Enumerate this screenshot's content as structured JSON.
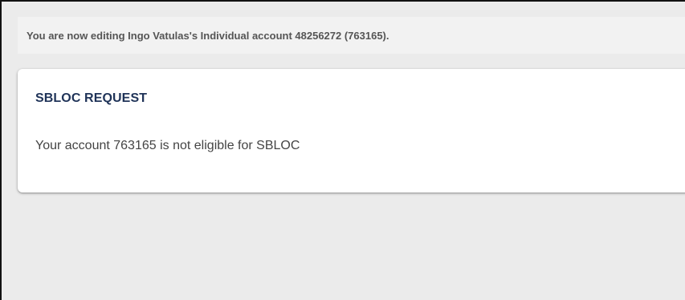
{
  "notice": {
    "text": "You are now editing Ingo Vatulas's Individual account 48256272 (763165)."
  },
  "card": {
    "title": "SBLOC REQUEST",
    "message": "Your account 763165 is not eligible for SBLOC"
  },
  "colors": {
    "page_background": "#ebebeb",
    "notice_background": "#f2f2f2",
    "card_background": "#ffffff",
    "title_color": "#1f3358",
    "message_color": "#444444"
  }
}
